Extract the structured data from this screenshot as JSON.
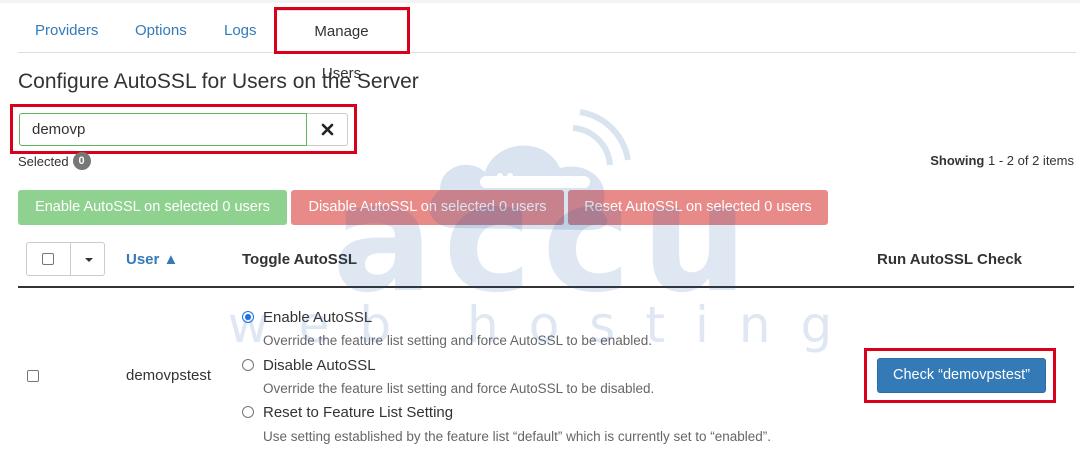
{
  "tabs": [
    {
      "label": "Providers"
    },
    {
      "label": "Options"
    },
    {
      "label": "Logs"
    },
    {
      "label": "Manage Users",
      "active": true
    }
  ],
  "page_title": "Configure AutoSSL for Users on the Server",
  "search": {
    "value": "demovp",
    "clear_icon": "close-icon"
  },
  "selected": {
    "label": "Selected",
    "count": "0"
  },
  "showing": {
    "label": "Showing",
    "range": "1 - 2 of 2 items"
  },
  "bulk_actions": {
    "enable": "Enable AutoSSL on selected 0 users",
    "disable": "Disable AutoSSL on selected 0 users",
    "reset": "Reset AutoSSL on selected 0 users"
  },
  "table": {
    "headers": {
      "user": "User ▲",
      "toggle": "Toggle AutoSSL",
      "run": "Run AutoSSL Check"
    },
    "rows": [
      {
        "user": "demovpstest",
        "options": [
          {
            "label": "Enable AutoSSL",
            "desc": "Override the feature list setting and force AutoSSL to be enabled.",
            "checked": true
          },
          {
            "label": "Disable AutoSSL",
            "desc": "Override the feature list setting and force AutoSSL to be disabled.",
            "checked": false
          },
          {
            "label": "Reset to Feature List Setting",
            "desc": "Use setting established by the feature list “default” which is currently set to “enabled”.",
            "checked": false
          }
        ],
        "check_button": "Check “demovpstest”"
      }
    ]
  },
  "watermark": {
    "brand": "accu",
    "tagline": "web hosting"
  },
  "colors": {
    "link": "#337ab7",
    "highlight": "#d9001b",
    "success": "#8fd18f",
    "danger": "#e88a88",
    "primary": "#337ab7"
  }
}
